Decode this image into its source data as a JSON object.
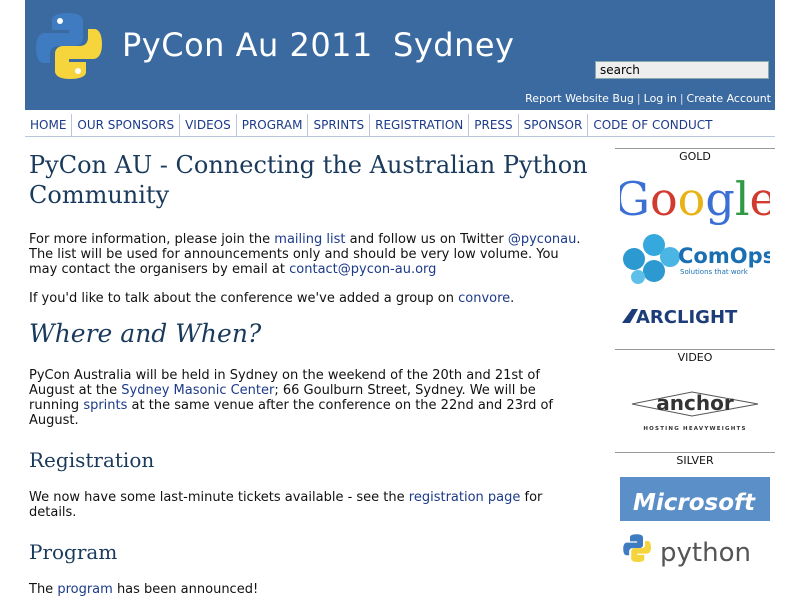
{
  "header": {
    "title": "PyCon Au 2011",
    "city": "Sydney",
    "search_value": "search",
    "links": [
      "Report Website Bug",
      "Log in",
      "Create Account"
    ]
  },
  "nav": [
    "HOME",
    "OUR SPONSORS",
    "VIDEOS",
    "PROGRAM",
    "SPRINTS",
    "REGISTRATION",
    "PRESS",
    "SPONSOR",
    "CODE OF CONDUCT"
  ],
  "main": {
    "title": "PyCon AU - Connecting the Australian Python Community",
    "intro": {
      "t1": "For more information, please join the ",
      "l1": "mailing list",
      "t2": " and follow us on Twitter ",
      "l2": "@pyconau",
      "t3": ". The list will be used for announcements only and should be very low volume. You may contact the organisers by email at ",
      "l3": "contact@pycon-au.org"
    },
    "convore": {
      "t1": "If you'd like to talk about the conference we've added a group on ",
      "l1": "convore",
      "t2": "."
    },
    "where_heading": "Where and When?",
    "where": {
      "t1": "PyCon Australia will be held in Sydney on the weekend of the 20th and 21st of August at the ",
      "l1": "Sydney Masonic Center",
      "t2": "; 66 Goulburn Street, Sydney. We will be running ",
      "l2": "sprints",
      "t3": " at the same venue after the conference on the 22nd and 23rd of August."
    },
    "registration_heading": "Registration",
    "registration": {
      "t1": "We now have some last-minute tickets available - see the ",
      "l1": "registration page",
      "t2": " for details."
    },
    "program_heading": "Program",
    "program": {
      "t1": "The ",
      "l1": "program",
      "t2": " has been announced!"
    }
  },
  "sidebar": {
    "gold_label": "GOLD",
    "video_label": "VIDEO",
    "silver_label": "SILVER",
    "sponsors": {
      "google": "Google",
      "comops": "ComOps",
      "comops_tag": "Solutions that work",
      "arclight": "ARCLIGHT",
      "anchor": "anchor",
      "anchor_tag": "HOSTING HEAVYWEIGHTS",
      "microsoft": "Microsoft",
      "python": "python"
    }
  },
  "colors": {
    "header_bg": "#3a6aa0",
    "link": "#1c3a8a",
    "heading": "#1a3a5c"
  }
}
